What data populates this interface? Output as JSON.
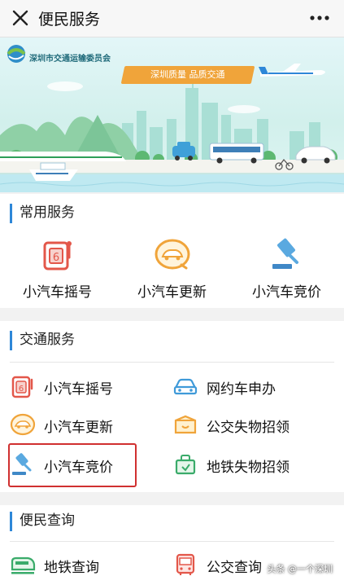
{
  "topbar": {
    "title": "便民服务"
  },
  "banner": {
    "org_name": "深圳市交通运输委员会",
    "slogan": "深圳质量  品质交通"
  },
  "sections": {
    "common": {
      "title": "常用服务",
      "items": [
        {
          "label": "小汽车摇号",
          "icon": "lottery-icon"
        },
        {
          "label": "小汽车更新",
          "icon": "car-update-icon"
        },
        {
          "label": "小汽车竞价",
          "icon": "auction-hammer-icon"
        }
      ]
    },
    "traffic": {
      "title": "交通服务",
      "items": [
        {
          "label": "小汽车摇号",
          "icon": "lottery-icon"
        },
        {
          "label": "网约车申办",
          "icon": "car-icon"
        },
        {
          "label": "小汽车更新",
          "icon": "car-update-icon"
        },
        {
          "label": "公交失物招领",
          "icon": "lost-box-icon"
        },
        {
          "label": "小汽车竞价",
          "icon": "auction-hammer-icon"
        },
        {
          "label": "地铁失物招领",
          "icon": "bag-icon"
        }
      ]
    },
    "query": {
      "title": "便民查询",
      "items": [
        {
          "label": "地铁查询",
          "icon": "metro-icon"
        },
        {
          "label": "公交查询",
          "icon": "bus-icon"
        }
      ]
    }
  },
  "watermark": "头条 @一个深圳",
  "colors": {
    "accent": "#2e87d8",
    "highlight": "#d03030",
    "orange": "#f0a43a",
    "blue_icon": "#3f9ad9",
    "green_icon": "#3aab6a"
  }
}
